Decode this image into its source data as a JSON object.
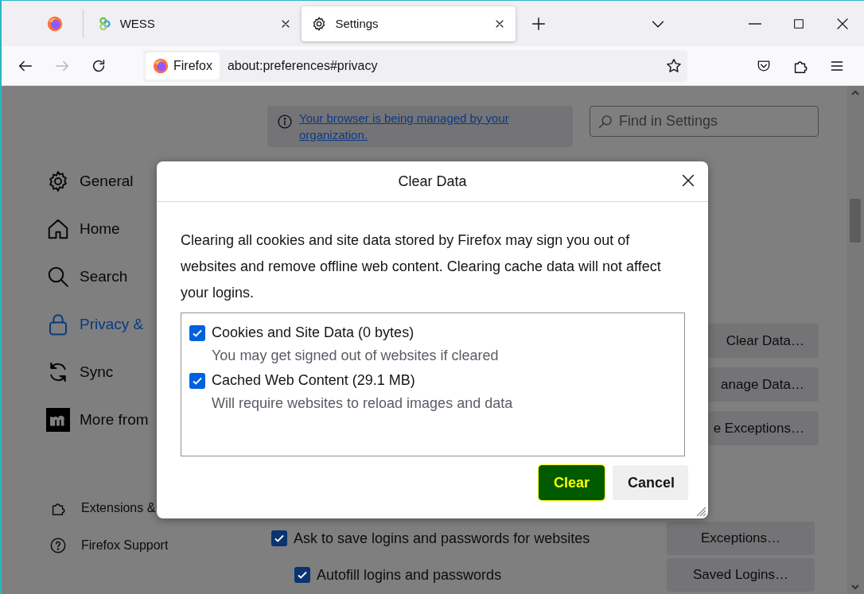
{
  "tabs": [
    {
      "kind": "pinned",
      "selected": false
    },
    {
      "kind": "site",
      "label": "WESS",
      "selected": false
    },
    {
      "kind": "settings",
      "label": "Settings",
      "selected": true
    }
  ],
  "nav": {
    "back_disabled": false,
    "forward_disabled": true
  },
  "url_bar": {
    "identity": "Firefox",
    "url": "about:preferences#privacy"
  },
  "notice": {
    "link": "Your browser is being managed by your organization."
  },
  "search": {
    "placeholder": "Find in Settings"
  },
  "sidebar": {
    "items": [
      {
        "kind": "gear",
        "label": "General",
        "selected": false
      },
      {
        "kind": "home",
        "label": "Home",
        "selected": false
      },
      {
        "kind": "search",
        "label": "Search",
        "selected": false
      },
      {
        "kind": "lock",
        "label": "Privacy &",
        "selected": true
      },
      {
        "kind": "sync",
        "label": "Sync",
        "selected": false
      },
      {
        "kind": "mozilla",
        "label": "More from",
        "selected": false
      }
    ],
    "footer": [
      {
        "kind": "puzzle",
        "label": "Extensions &"
      },
      {
        "kind": "help",
        "label": "Firefox Support"
      }
    ]
  },
  "page_buttons": [
    {
      "label": "Clear Data…"
    },
    {
      "label": "anage Data…"
    },
    {
      "label": "e Exceptions…"
    }
  ],
  "logins": {
    "options": [
      {
        "label": "Ask to save logins and passwords for websites",
        "checked": true,
        "button": {
          "label": "Exceptions…"
        }
      },
      {
        "label": "Autofill logins and passwords",
        "checked": true,
        "button": {
          "label": "Saved Logins…"
        }
      }
    ]
  },
  "dialog": {
    "title": "Clear Data",
    "message": "Clearing all cookies and site data stored by Firefox may sign you out of websites and remove offline web content. Clearing cache data will not affect your logins.",
    "options": [
      {
        "label": "Cookies and Site Data (0 bytes)",
        "description": "You may get signed out of websites if cleared",
        "checked": true
      },
      {
        "label": "Cached Web Content (29.1 MB)",
        "description": "Will require websites to reload images and data",
        "checked": true
      }
    ],
    "buttons": [
      {
        "kind": "primary",
        "label": "Clear"
      },
      {
        "kind": "secondary",
        "label": "Cancel"
      }
    ]
  }
}
